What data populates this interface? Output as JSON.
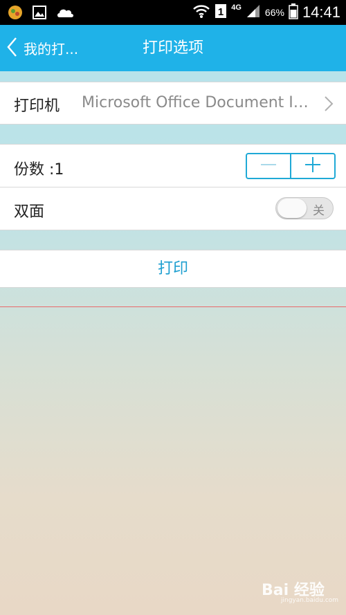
{
  "status_bar": {
    "network": "4G",
    "battery": "66%",
    "time": "14:41",
    "icons": [
      "app-icon",
      "gallery-icon",
      "cloud-icon",
      "wifi-icon",
      "sim-icon",
      "signal-icon",
      "battery-icon"
    ]
  },
  "app_bar": {
    "back_label": "我的打...",
    "title": "打印选项",
    "color": "#1fb2e8"
  },
  "printer": {
    "label": "打印机",
    "value": "Microsoft Office Document Image Writer"
  },
  "copies": {
    "label": "份数 :1",
    "value": 1
  },
  "duplex": {
    "label": "双面",
    "state_label": "关",
    "on": false
  },
  "print_button": {
    "label": "打印",
    "color": "#1e9fd0"
  },
  "watermark": {
    "brand": "Bai 经验",
    "url": "jingyan.baidu.com"
  }
}
